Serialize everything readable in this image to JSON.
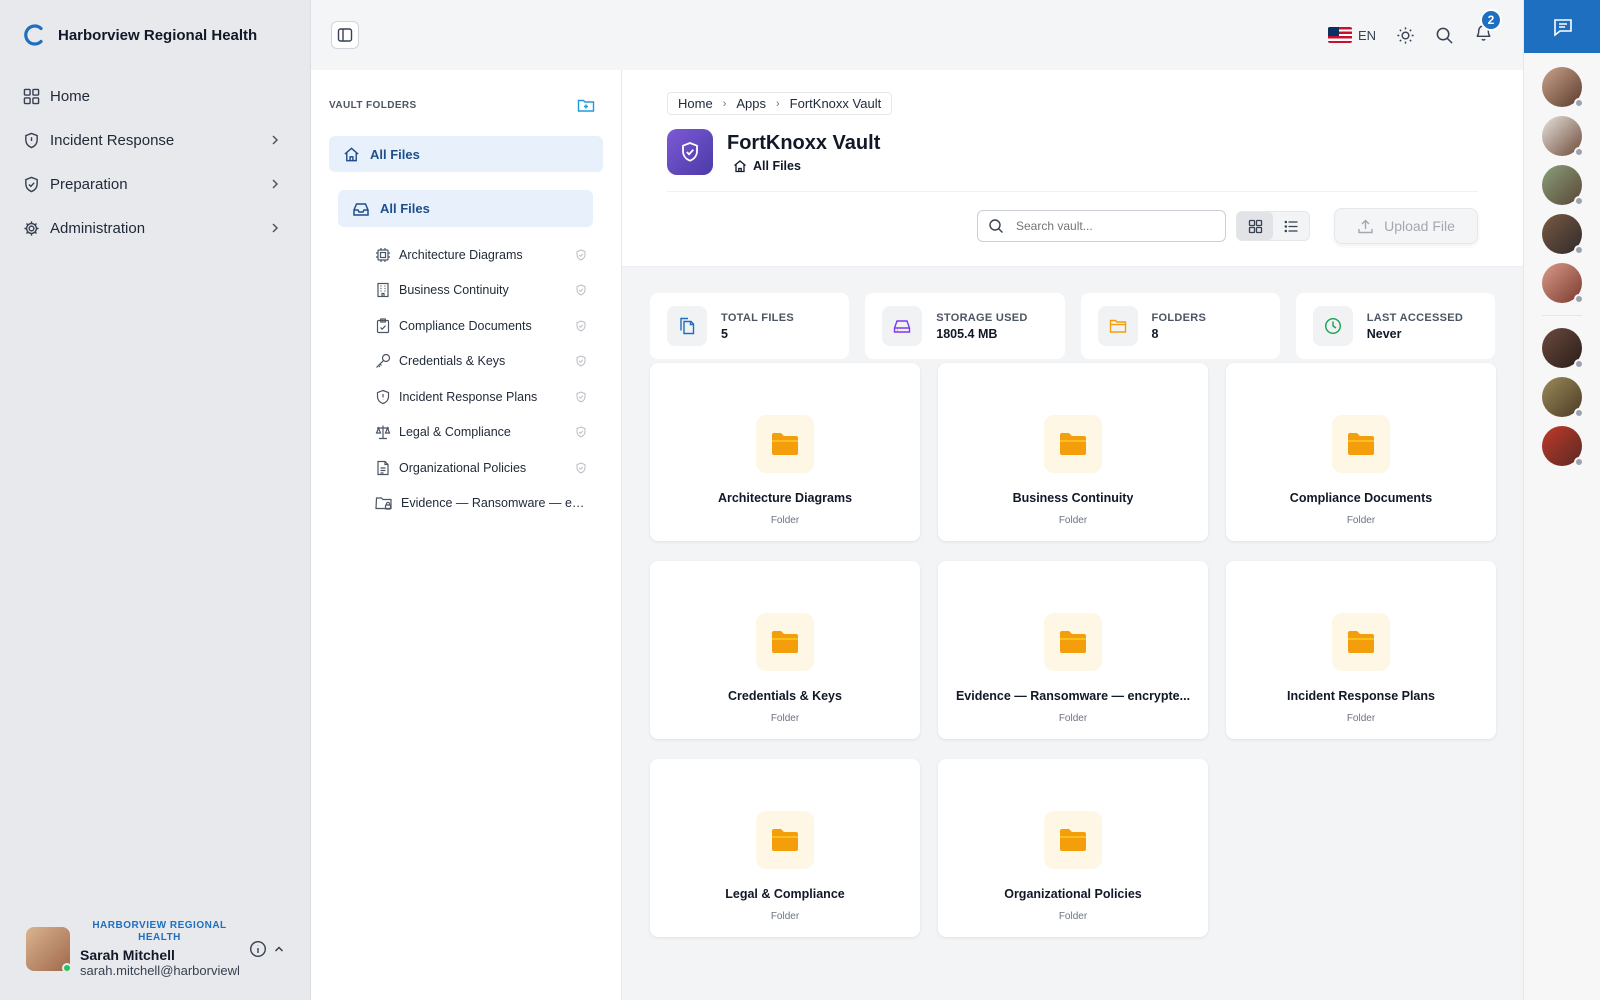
{
  "app": {
    "name": "Harborview Regional Health"
  },
  "nav": {
    "items": [
      {
        "label": "Home",
        "icon": "grid-icon",
        "has_children": false
      },
      {
        "label": "Incident Response",
        "icon": "shield-alert-icon",
        "has_children": true
      },
      {
        "label": "Preparation",
        "icon": "shield-check-icon",
        "has_children": true
      },
      {
        "label": "Administration",
        "icon": "gear-icon",
        "has_children": true
      }
    ]
  },
  "user": {
    "org": "HARBORVIEW REGIONAL HEALTH",
    "name": "Sarah Mitchell",
    "email": "sarah.mitchell@harborviewh",
    "status": "online"
  },
  "topbar": {
    "language": "EN",
    "notifications_count": "2"
  },
  "folder_panel": {
    "title": "VAULT FOLDERS",
    "root_label": "All Files",
    "sub_label": "All Files",
    "folders": [
      {
        "label": "Architecture Diagrams",
        "icon": "cpu-icon",
        "protected": true
      },
      {
        "label": "Business Continuity",
        "icon": "building-icon",
        "protected": true
      },
      {
        "label": "Compliance Documents",
        "icon": "clipboard-check-icon",
        "protected": true
      },
      {
        "label": "Credentials & Keys",
        "icon": "key-icon",
        "protected": true
      },
      {
        "label": "Incident Response Plans",
        "icon": "shield-alert-icon",
        "protected": true
      },
      {
        "label": "Legal & Compliance",
        "icon": "scale-icon",
        "protected": true
      },
      {
        "label": "Organizational Policies",
        "icon": "document-icon",
        "protected": true
      },
      {
        "label": "Evidence — Ransomware — en...",
        "icon": "folder-lock-icon",
        "protected": false
      }
    ]
  },
  "main": {
    "breadcrumbs": [
      "Home",
      "Apps",
      "FortKnoxx Vault"
    ],
    "title": "FortKnoxx Vault",
    "subtitle": "All Files",
    "search_placeholder": "Search vault...",
    "upload_label": "Upload File",
    "view_mode": "grid",
    "stats": [
      {
        "label": "TOTAL FILES",
        "value": "5",
        "icon": "files-icon",
        "color": "#1e6fbf"
      },
      {
        "label": "STORAGE USED",
        "value": "1805.4 MB",
        "icon": "hard-drive-icon",
        "color": "#7c3aed"
      },
      {
        "label": "FOLDERS",
        "value": "8",
        "icon": "folder-icon",
        "color": "#f59e0b"
      },
      {
        "label": "LAST ACCESSED",
        "value": "Never",
        "icon": "clock-icon",
        "color": "#16a34a"
      }
    ],
    "cards": [
      {
        "name": "Architecture Diagrams",
        "type": "Folder"
      },
      {
        "name": "Business Continuity",
        "type": "Folder"
      },
      {
        "name": "Compliance Documents",
        "type": "Folder"
      },
      {
        "name": "Credentials & Keys",
        "type": "Folder"
      },
      {
        "name": "Evidence — Ransomware — encrypte...",
        "type": "Folder"
      },
      {
        "name": "Incident Response Plans",
        "type": "Folder"
      },
      {
        "name": "Legal & Compliance",
        "type": "Folder"
      },
      {
        "name": "Organizational Policies",
        "type": "Folder"
      }
    ]
  },
  "colors": {
    "accent": "#1e6fbf",
    "folder": "#f59e0b",
    "vault": "#5b45b8"
  }
}
